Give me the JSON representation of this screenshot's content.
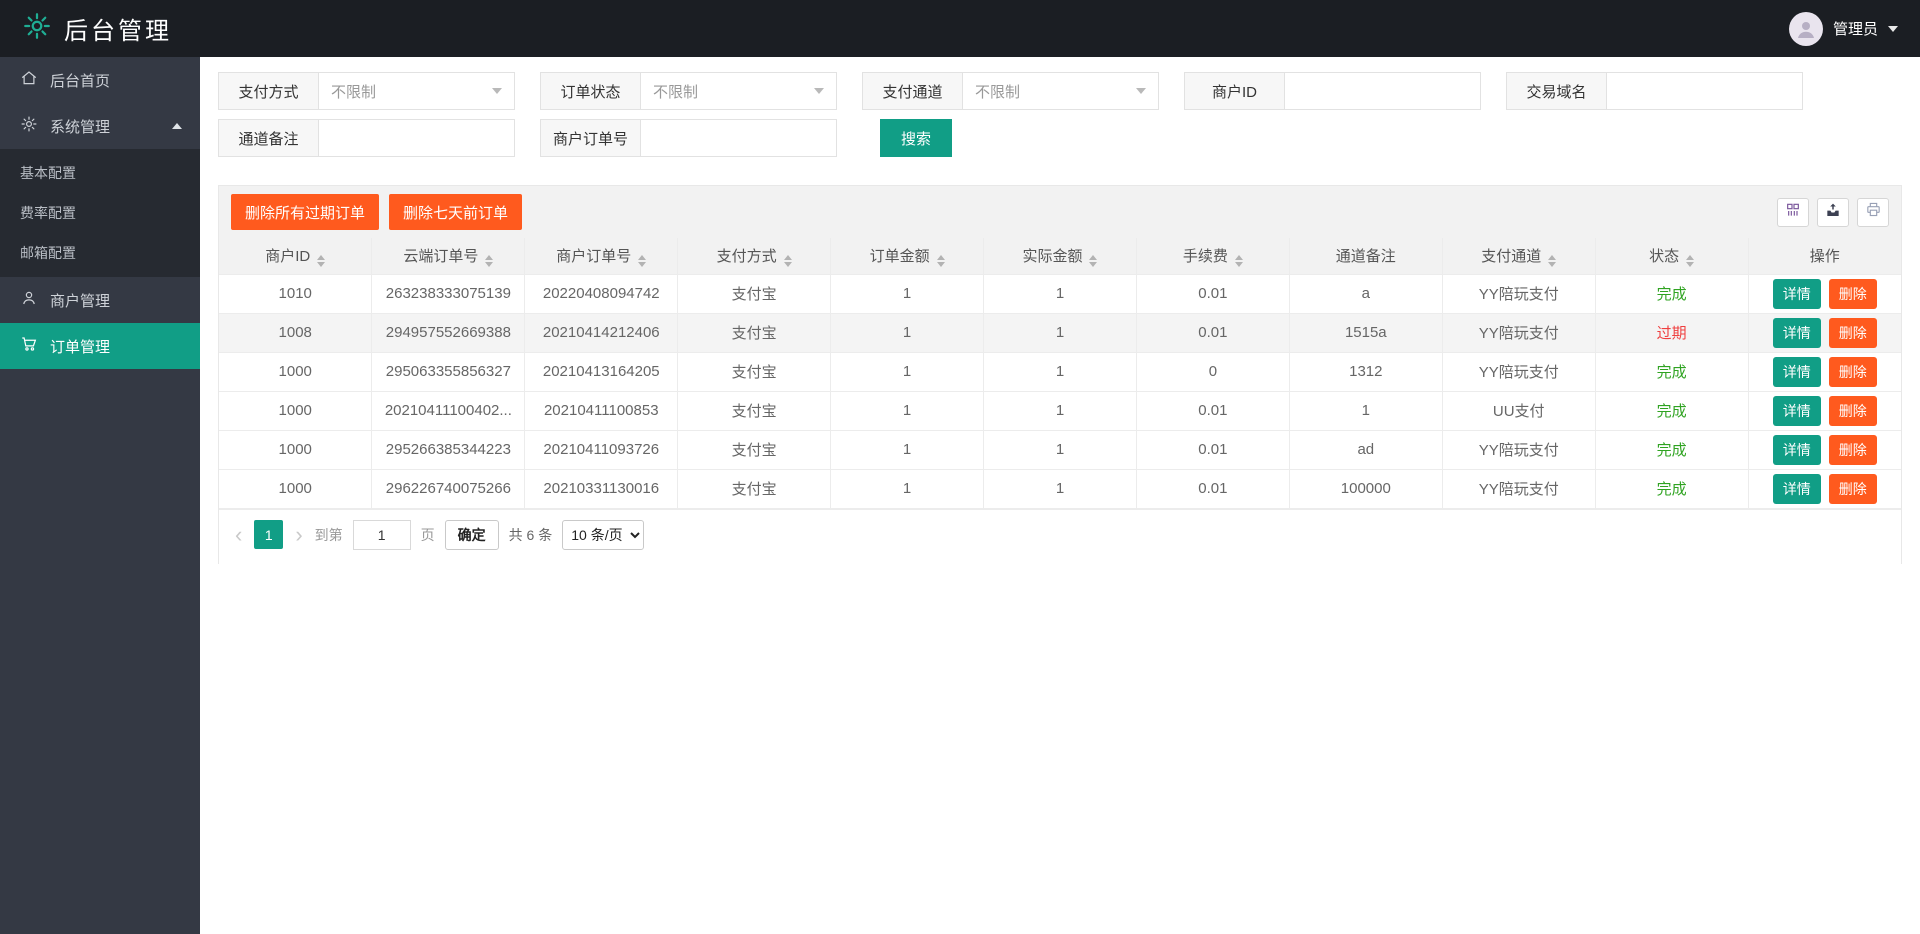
{
  "theme": {
    "teal": "#119e86",
    "orange": "#ff5a1e",
    "status_green": "#2fa321",
    "status_red": "#ef3f3f",
    "header_bg": "#1b1e23",
    "sidebar_bg": "#343944",
    "submenu_bg": "#262a31"
  },
  "header": {
    "title": "后台管理",
    "user_name": "管理员"
  },
  "sidebar": {
    "items": [
      {
        "label": "后台首页",
        "icon": "home-icon"
      },
      {
        "label": "系统管理",
        "icon": "gear-icon",
        "expanded": true
      },
      {
        "label": "基本配置"
      },
      {
        "label": "费率配置"
      },
      {
        "label": "邮箱配置"
      },
      {
        "label": "商户管理",
        "icon": "user-icon"
      },
      {
        "label": "订单管理",
        "icon": "cart-icon",
        "active": true
      }
    ]
  },
  "filters": {
    "fields": [
      {
        "label": "支付方式",
        "type": "select",
        "value": "不限制"
      },
      {
        "label": "订单状态",
        "type": "select",
        "value": "不限制"
      },
      {
        "label": "支付通道",
        "type": "select",
        "value": "不限制"
      },
      {
        "label": "商户ID",
        "type": "text",
        "value": ""
      },
      {
        "label": "交易域名",
        "type": "text",
        "value": ""
      },
      {
        "label": "通道备注",
        "type": "text",
        "value": ""
      },
      {
        "label": "商户订单号",
        "type": "text",
        "value": ""
      }
    ],
    "search_button": "搜索"
  },
  "toolbar": {
    "delete_expired_button": "删除所有过期订单",
    "delete_week_button": "删除七天前订单",
    "icons": [
      "columns-icon",
      "export-icon",
      "print-icon"
    ]
  },
  "table": {
    "columns": [
      {
        "label": "商户ID",
        "sortable": true
      },
      {
        "label": "云端订单号",
        "sortable": true
      },
      {
        "label": "商户订单号",
        "sortable": true
      },
      {
        "label": "支付方式",
        "sortable": true
      },
      {
        "label": "订单金额",
        "sortable": true
      },
      {
        "label": "实际金额",
        "sortable": true
      },
      {
        "label": "手续费",
        "sortable": true
      },
      {
        "label": "通道备注",
        "sortable": false
      },
      {
        "label": "支付通道",
        "sortable": true
      },
      {
        "label": "状态",
        "sortable": true
      },
      {
        "label": "操作",
        "sortable": false
      }
    ],
    "rows": [
      {
        "cells": [
          "1010",
          "263238333075139",
          "20220408094742",
          "支付宝",
          "1",
          "1",
          "0.01",
          "a",
          "YY陪玩支付"
        ],
        "status": "完成",
        "status_type": "success",
        "highlight": false
      },
      {
        "cells": [
          "1008",
          "294957552669388",
          "20210414212406",
          "支付宝",
          "1",
          "1",
          "0.01",
          "1515a",
          "YY陪玩支付"
        ],
        "status": "过期",
        "status_type": "expired",
        "highlight": true
      },
      {
        "cells": [
          "1000",
          "295063355856327",
          "20210413164205",
          "支付宝",
          "1",
          "1",
          "0",
          "1312",
          "YY陪玩支付"
        ],
        "status": "完成",
        "status_type": "success",
        "highlight": false
      },
      {
        "cells": [
          "1000",
          "20210411100402...",
          "20210411100853",
          "支付宝",
          "1",
          "1",
          "0.01",
          "1",
          "UU支付"
        ],
        "status": "完成",
        "status_type": "success",
        "highlight": false
      },
      {
        "cells": [
          "1000",
          "295266385344223",
          "20210411093726",
          "支付宝",
          "1",
          "1",
          "0.01",
          "ad",
          "YY陪玩支付"
        ],
        "status": "完成",
        "status_type": "success",
        "highlight": false
      },
      {
        "cells": [
          "1000",
          "296226740075266",
          "20210331130016",
          "支付宝",
          "1",
          "1",
          "0.01",
          "100000",
          "YY陪玩支付"
        ],
        "status": "完成",
        "status_type": "success",
        "highlight": false
      }
    ],
    "row_actions": {
      "detail": "详情",
      "delete": "删除"
    }
  },
  "pagination": {
    "prev_icon": "‹",
    "next_icon": "›",
    "current_page": "1",
    "goto_prefix": "到第",
    "goto_value": "1",
    "goto_suffix": "页",
    "confirm_button": "确定",
    "total_text": "共 6 条",
    "page_size_value": "10 条/页"
  }
}
